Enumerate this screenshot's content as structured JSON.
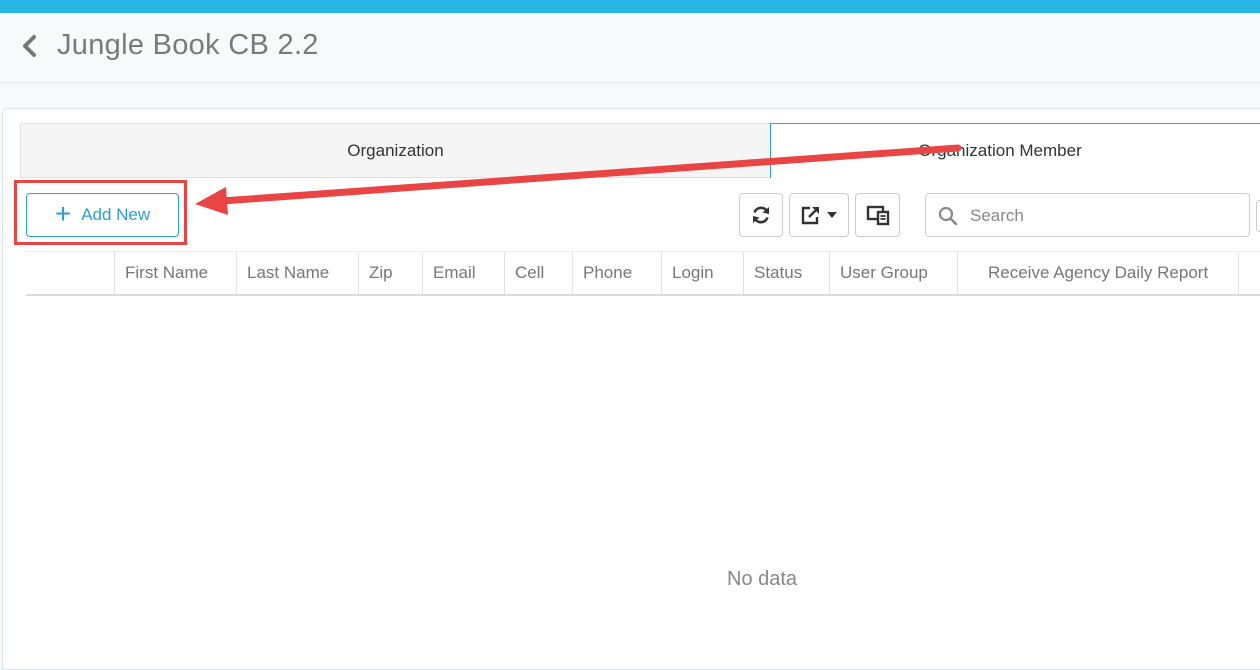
{
  "header": {
    "title": "Jungle Book CB 2.2"
  },
  "tabs": [
    {
      "label": "Organization"
    },
    {
      "label": "Organization Member"
    }
  ],
  "toolbar": {
    "add_new_label": "Add New",
    "search_placeholder": "Search"
  },
  "table": {
    "columns": [
      "First Name",
      "Last Name",
      "Zip",
      "Email",
      "Cell",
      "Phone",
      "Login",
      "Status",
      "User Group",
      "Receive Agency Daily Report"
    ],
    "empty_text": "No data"
  },
  "colors": {
    "accent": "#2a9fd6",
    "topbar": "#29b6e4",
    "annotation": "#e94545"
  }
}
